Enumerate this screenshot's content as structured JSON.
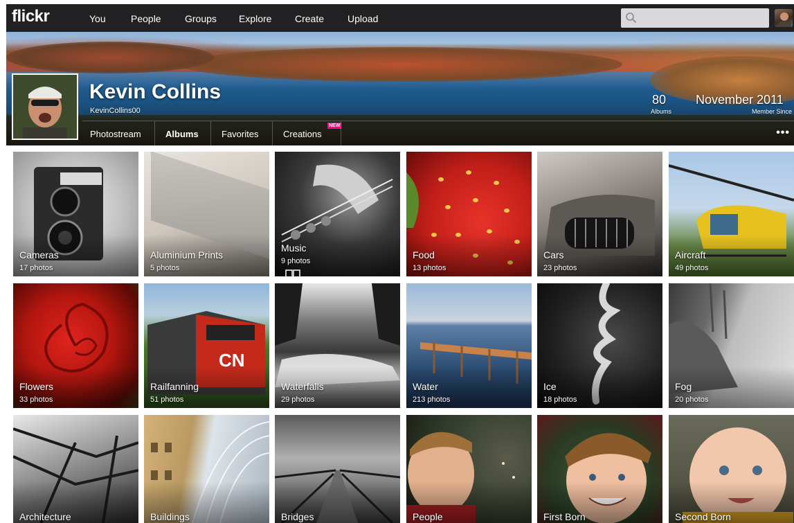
{
  "nav": {
    "logo": "flickr",
    "items": [
      "You",
      "People",
      "Groups",
      "Explore",
      "Create",
      "Upload"
    ],
    "search_placeholder": ""
  },
  "profile": {
    "name": "Kevin Collins",
    "username": "KevinCollins00",
    "albums_count": "80",
    "albums_label": "Albums",
    "member_since": "November 2011",
    "member_since_label": "Member Since"
  },
  "subnav": {
    "items": [
      "Photostream",
      "Albums",
      "Favorites",
      "Creations"
    ],
    "active": "Albums",
    "new_badge": "NEW",
    "more": "•••"
  },
  "albums": [
    {
      "title": "Cameras",
      "count": "17 photos"
    },
    {
      "title": "Aluminium Prints",
      "count": "5 photos"
    },
    {
      "title": "Music",
      "count": "9 photos"
    },
    {
      "title": "Food",
      "count": "13 photos"
    },
    {
      "title": "Cars",
      "count": "23 photos"
    },
    {
      "title": "Aircraft",
      "count": "49 photos"
    },
    {
      "title": "Flowers",
      "count": "33 photos"
    },
    {
      "title": "Railfanning",
      "count": "51 photos"
    },
    {
      "title": "Waterfalls",
      "count": "29 photos"
    },
    {
      "title": "Water",
      "count": "213 photos"
    },
    {
      "title": "Ice",
      "count": "18 photos"
    },
    {
      "title": "Fog",
      "count": "20 photos"
    },
    {
      "title": "Architecture",
      "count": ""
    },
    {
      "title": "Buildings",
      "count": ""
    },
    {
      "title": "Bridges",
      "count": ""
    },
    {
      "title": "People",
      "count": ""
    },
    {
      "title": "First Born",
      "count": ""
    },
    {
      "title": "Second Born",
      "count": ""
    }
  ]
}
